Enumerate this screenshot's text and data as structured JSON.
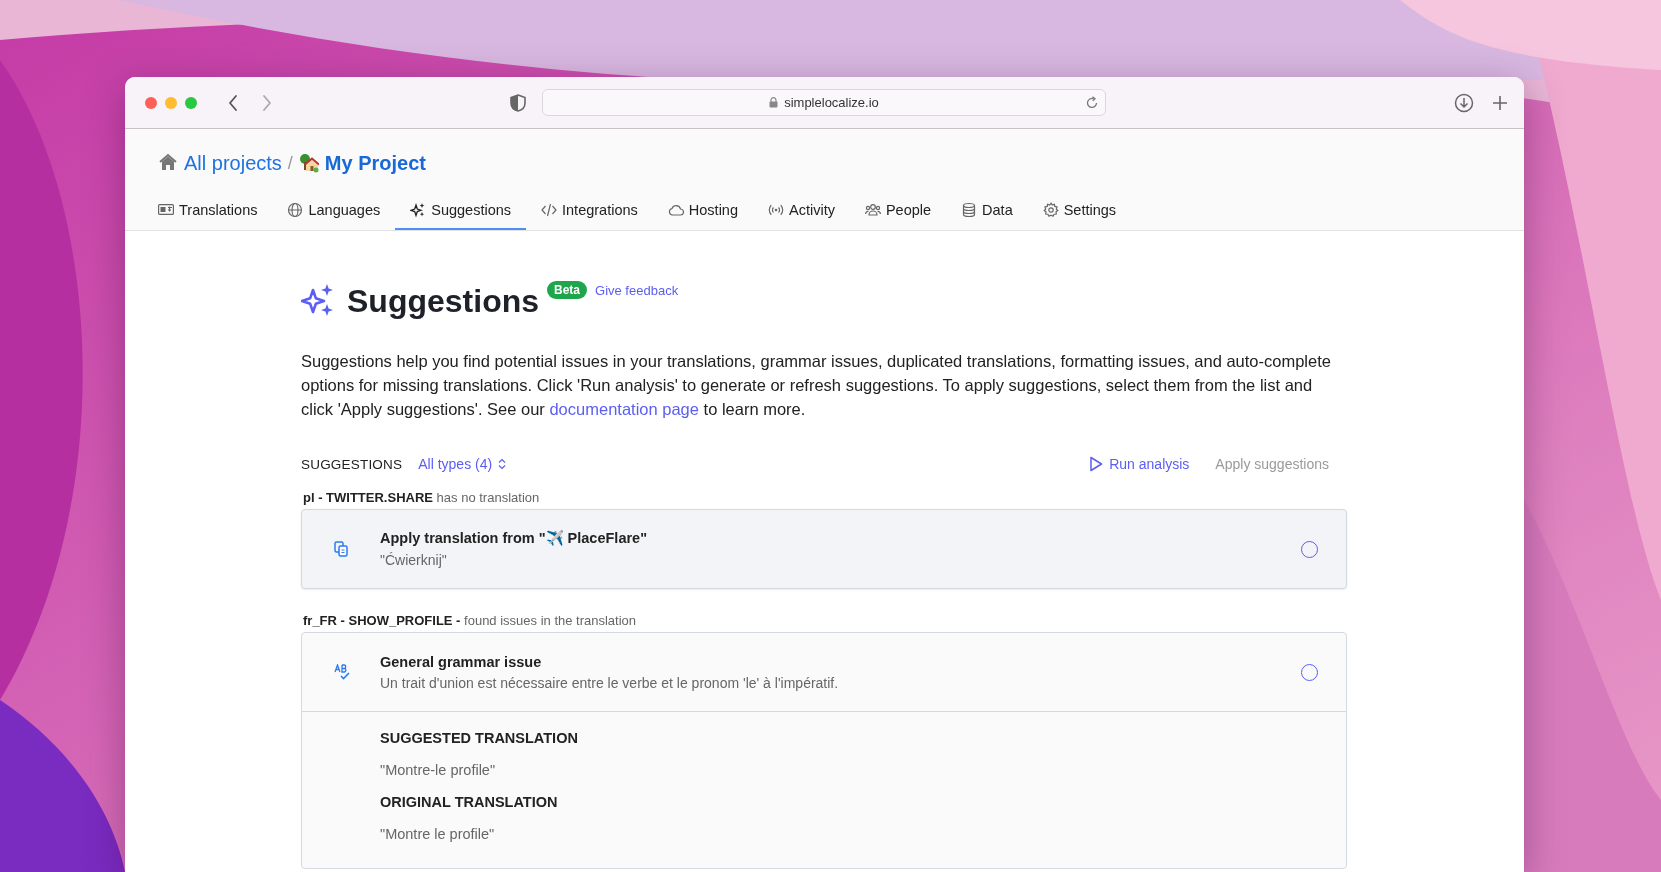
{
  "browser": {
    "url": "simplelocalize.io"
  },
  "breadcrumb_separator": "/",
  "breadcrumb": [
    {
      "label": "All projects",
      "kind": "home"
    },
    {
      "label": "My Project",
      "kind": "project"
    }
  ],
  "tabs": [
    {
      "label": "Translations",
      "selected": false
    },
    {
      "label": "Languages",
      "selected": false
    },
    {
      "label": "Suggestions",
      "selected": true
    },
    {
      "label": "Integrations",
      "selected": false
    },
    {
      "label": "Hosting",
      "selected": false
    },
    {
      "label": "Activity",
      "selected": false
    },
    {
      "label": "People",
      "selected": false
    },
    {
      "label": "Data",
      "selected": false
    },
    {
      "label": "Settings",
      "selected": false
    }
  ],
  "header": {
    "title": "Suggestions",
    "badge": "Beta",
    "feedback_link": "Give feedback"
  },
  "description": {
    "before": "Suggestions help you find potential issues in your translations, grammar issues, duplicated translations, formatting issues, and auto-complete options for missing translations. Click 'Run analysis' to generate or refresh suggestions. To apply suggestions, select them from the list and click 'Apply suggestions'. See our",
    "link": "documentation page",
    "after": "to learn more."
  },
  "toolbar": {
    "label": "SUGGESTIONS",
    "filter": "All types (4)",
    "run_button": "Run analysis",
    "apply_button": {
      "label": "Apply suggestions",
      "disabled": true
    }
  },
  "groups": [
    {
      "key": "pl - TWITTER.SHARE",
      "note": "has no translation",
      "kind": "translation",
      "highlighted": true,
      "title": "Apply translation from \"✈️ PlaceFlare\"",
      "detail": "\"Ćwierknij\"",
      "selected": false
    },
    {
      "key": "fr_FR - SHOW_PROFILE -",
      "note": "found issues in the translation",
      "kind": "grammar",
      "highlighted": false,
      "title": "General grammar issue",
      "detail": "Un trait d'union est nécessaire entre le verbe et le pronom 'le' à l'impératif.",
      "selected": false,
      "sections": [
        {
          "heading": "SUGGESTED TRANSLATION",
          "value": "\"Montre-le profile\""
        },
        {
          "heading": "ORIGINAL TRANSLATION",
          "value": "\"Montre le profile\""
        }
      ]
    }
  ]
}
